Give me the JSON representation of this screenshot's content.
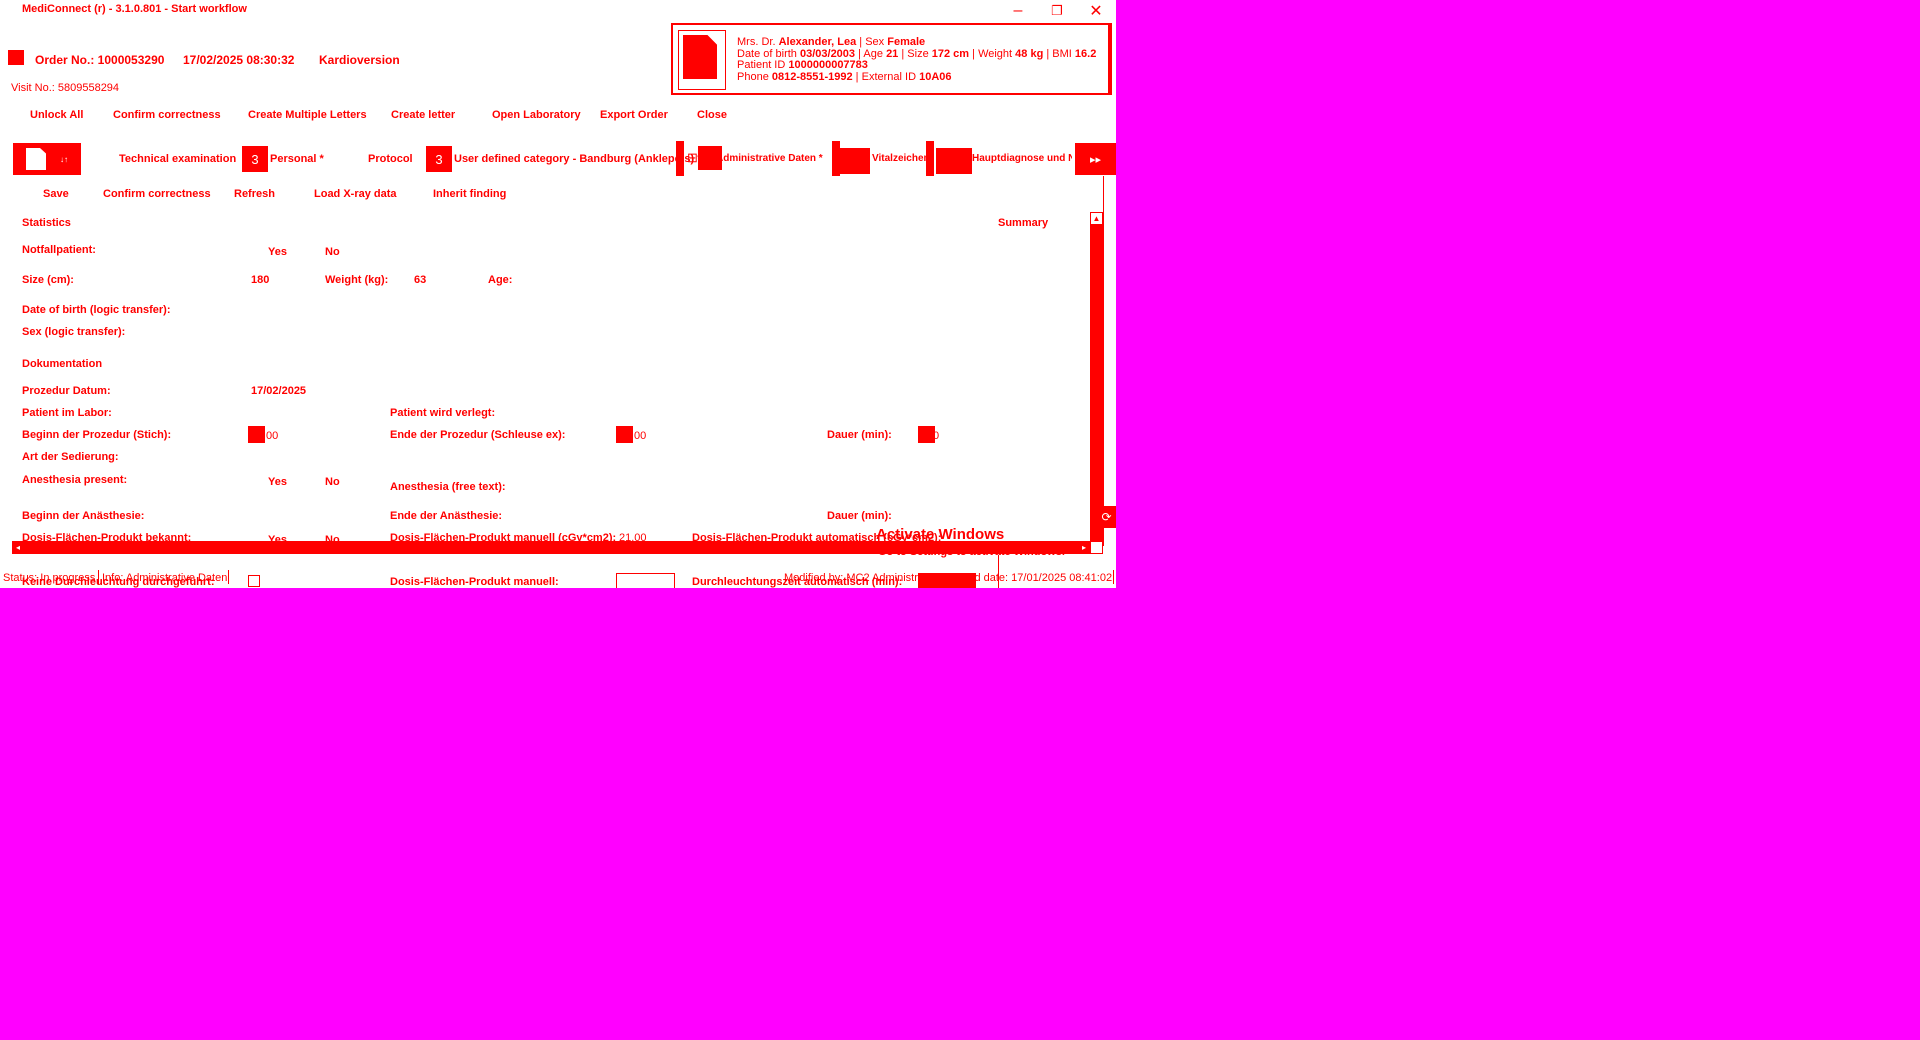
{
  "window": {
    "title": "MediConnect (r) - 3.1.0.801 - Start workflow",
    "minimize_glyph": "–",
    "maximize_glyph": "❐",
    "close_glyph": "✕"
  },
  "order": {
    "number": "Order No.: 1000053290",
    "datetime": "17/02/2025 08:30:32",
    "type": "Kardioversion",
    "visit": "Visit No.: 5809558294"
  },
  "patient": {
    "salutation": "Mrs. Dr.",
    "name": "Alexander, Lea",
    "sex_label": "Sex",
    "sex": "Female",
    "dob_label": "Date of birth",
    "dob": "03/03/2003",
    "age_label": "Age",
    "age": "21",
    "size_label": "Size",
    "size": "172 cm",
    "weight_label": "Weight",
    "weight": "48 kg",
    "bmi_label": "BMI",
    "bmi": "16.2",
    "pid_label": "Patient ID",
    "pid": "1000000007783",
    "phone_label": "Phone",
    "phone": "0812-8551-1992",
    "extid_label": "External ID",
    "extid": "10A06"
  },
  "toolbar": [
    "Unlock All",
    "Confirm correctness",
    "Create Multiple Letters",
    "Create letter",
    "Open Laboratory",
    "Export Order",
    "Close"
  ],
  "tabs": {
    "first_icon_badge": "↓↑",
    "technical": "Technical examination",
    "personal_icon": "3",
    "personal": "Personal *",
    "protocol": "Protocol",
    "user_icon": "3",
    "user_defined": "User defined category - Bandburg (Anklepois) *",
    "admin_icon": "⊞",
    "admin": "Administrative Daten *",
    "vitals": "Vitalzeichen",
    "tab7": "Hauptdiagnose und Nebendiagnose",
    "last": "▸▸"
  },
  "subtoolbar": [
    "Save",
    "Confirm correctness",
    "Refresh",
    "Load X-ray data",
    "Inherit finding"
  ],
  "form": {
    "section_stats": "Statistics",
    "summary": "Summary",
    "notfall_label": "Notfallpatient:",
    "yes": "Yes",
    "no": "No",
    "size_label": "Size (cm):",
    "size_value": "180",
    "weight_label": "Weight (kg):",
    "weight_value": "63",
    "age_label": "Age:",
    "dob_logic": "Date of birth (logic transfer):",
    "sex_logic": "Sex (logic transfer):",
    "section_doc": "Dokumentation",
    "proc_date_label": "Prozedur Datum:",
    "proc_date_value": "17/02/2025",
    "patient_labor": "Patient im Labor:",
    "patient_verlegt": "Patient wird verlegt:",
    "beginn_label": "Beginn der Prozedur (Stich):",
    "beginn_value": "00",
    "ende_label": "Ende der Prozedur (Schleuse ex):",
    "ende_value": "00",
    "dauer_label": "Dauer (min):",
    "dauer_value": "0",
    "sedierung": "Art der Sedierung:",
    "anaesthesia_present": "Anesthesia present:",
    "anaesthesia_free": "Anesthesia (free text):",
    "beginn_anaesth": "Beginn der Anästhesie:",
    "ende_anaesth": "Ende der Anästhesie:",
    "dauer_anaesth": "Dauer (min):",
    "dfp_known": "Dosis-Flächen-Produkt bekannt:",
    "dfp_manual_unit": "Dosis-Flächen-Produkt manuell (cGy*cm2):",
    "dfp_manual_unit_value": "21.00",
    "dfp_auto": "Dosis-Flächen-Produkt automatisch (cGy*cm2):",
    "keine_durchl": "Keine Durchleuchtung durchgeführt:",
    "dfp_manual": "Dosis-Flächen-Produkt manuell:",
    "durchl_auto": "Durchleuchtungszeit automatisch (min):"
  },
  "activate": {
    "title": "Activate Windows",
    "subtitle": "Go to Settings to activate Windows."
  },
  "statusbar": {
    "status": "Status: In progress",
    "info": "Info: Administrative Daten",
    "modified_by": "Modified by: MC2 Administrator",
    "modified_date": "Modified date: 17/01/2025 08:41:02"
  }
}
